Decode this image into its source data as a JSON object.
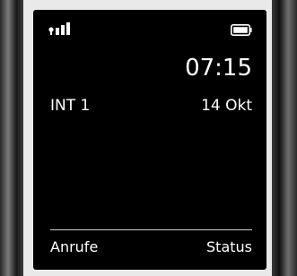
{
  "status_bar": {
    "signal_icon": "signal-strength-icon",
    "battery_icon": "battery-icon"
  },
  "clock": {
    "time": "07:15",
    "date": "14 Okt"
  },
  "handset": {
    "name": "INT 1"
  },
  "softkeys": {
    "left_label": "Anrufe",
    "right_label": "Status"
  },
  "colors": {
    "screen_background": "#000000",
    "text": "#ffffff"
  }
}
